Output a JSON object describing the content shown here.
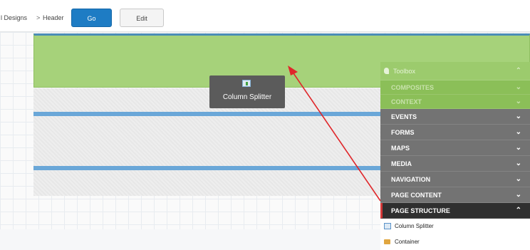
{
  "breadcrumb": {
    "item1": "l Designs",
    "separator": ">",
    "item2": "Header"
  },
  "toolbar": {
    "go_label": "Go",
    "edit_label": "Edit"
  },
  "drag_preview": {
    "label": "Column Splitter",
    "icon": "column-splitter-icon"
  },
  "toolbox": {
    "title": "Toolbox",
    "faded_categories": [
      "COMPOSITES",
      "CONTEXT"
    ],
    "categories": [
      "EVENTS",
      "FORMS",
      "MAPS",
      "MEDIA",
      "NAVIGATION",
      "PAGE CONTENT"
    ],
    "active_category": "PAGE STRUCTURE",
    "items": [
      {
        "label": "Column Splitter",
        "icon": "column-splitter-icon"
      },
      {
        "label": "Container",
        "icon": "folder-icon"
      }
    ]
  },
  "colors": {
    "header_region": "#a6d27a",
    "go_button": "#1e7cc4",
    "toolbox_category": "#737373",
    "active_category": "#2f2f2f",
    "arrow": "#e0262a"
  }
}
